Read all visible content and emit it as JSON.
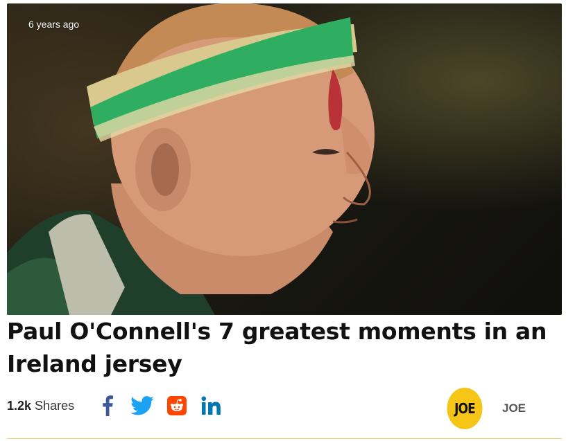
{
  "article": {
    "timestamp": "6 years ago",
    "headline": "Paul O'Connell's 7 greatest moments in an Ireland jersey",
    "image_alt": "Rugby player wearing green headband"
  },
  "shares": {
    "count": "1.2k",
    "label": "Shares"
  },
  "social": [
    {
      "name": "facebook-icon",
      "color": "#3b5998"
    },
    {
      "name": "twitter-icon",
      "color": "#1da1f2"
    },
    {
      "name": "reddit-icon",
      "color": "#ff4500"
    },
    {
      "name": "linkedin-icon",
      "color": "#0077b5"
    }
  ],
  "author": {
    "badge": "JOE",
    "name": "JOE",
    "badge_color": "#f5c518"
  }
}
